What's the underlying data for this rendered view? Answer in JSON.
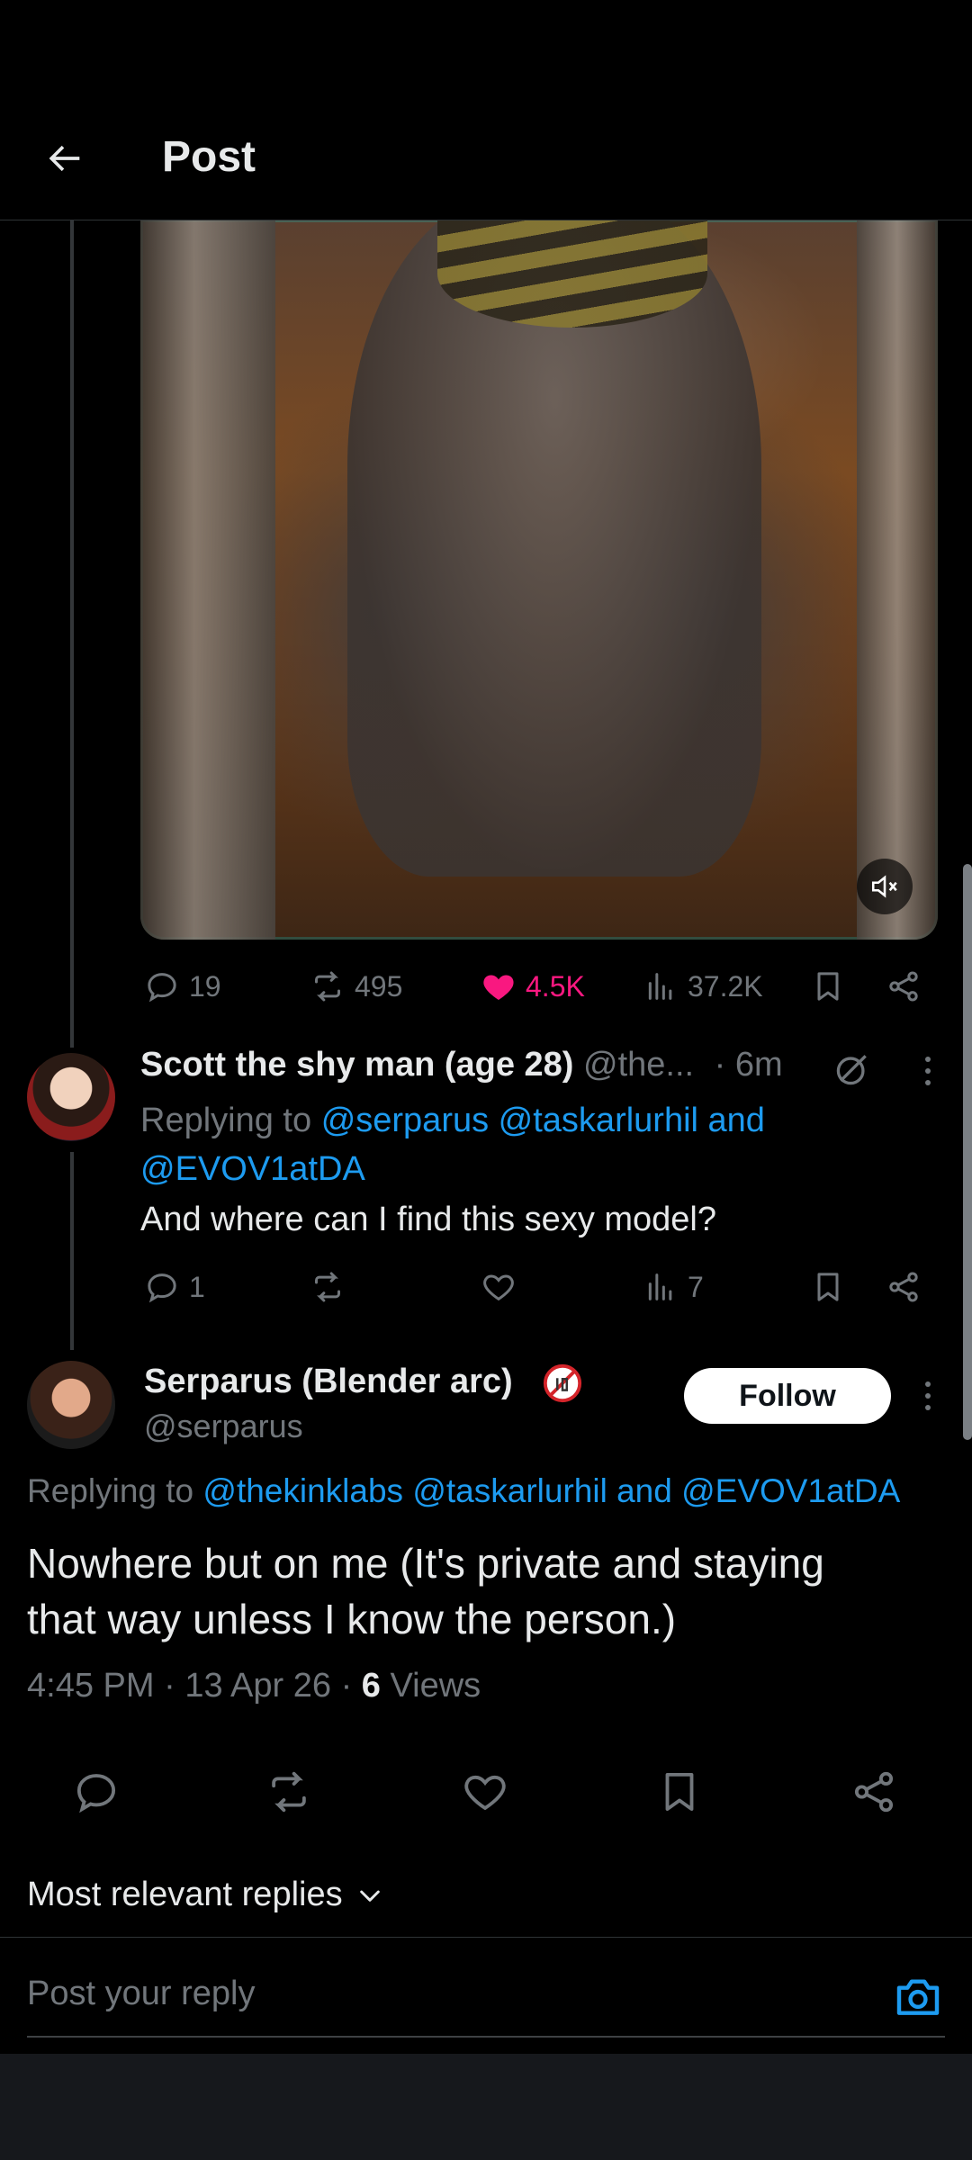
{
  "header": {
    "title": "Post",
    "back_icon": "arrow-left-icon"
  },
  "media": {
    "mute_icon": "volume-muted-icon"
  },
  "parent_post_actions": {
    "replies": "19",
    "reposts": "495",
    "likes": "4.5K",
    "views": "37.2K",
    "liked_color": "#f91880"
  },
  "reply_comment": {
    "author_name": "Scott the shy man (age 28)",
    "handle": "@the...",
    "time": "· 6m",
    "replying_prefix": "Replying to",
    "replying_users_line1": "@serparus @taskarlurhil and",
    "replying_users_line2": "@EVOV1atDA",
    "text": "And where can I find this sexy model?",
    "actions": {
      "replies": "1",
      "views": "7"
    }
  },
  "main_post": {
    "author_name": "Serparus (Blender arc)",
    "handle": "@serparus",
    "follow_label": "Follow",
    "replying_prefix": "Replying to",
    "replying_users": "@thekinklabs @taskarlurhil and @EVOV1atDA",
    "text_line1": "Nowhere but on me (It's private and staying",
    "text_line2": "that way unless I know the person.)",
    "time": "4:45 PM",
    "date": "13 Apr 26",
    "views_count": "6",
    "views_label": "Views"
  },
  "sort": {
    "label": "Most relevant replies"
  },
  "composer": {
    "placeholder": "Post your reply",
    "camera_icon": "camera-icon"
  },
  "colors": {
    "accent": "#1d9bf0",
    "like": "#f91880",
    "text": "#e7e9ea",
    "muted": "#71767b"
  }
}
